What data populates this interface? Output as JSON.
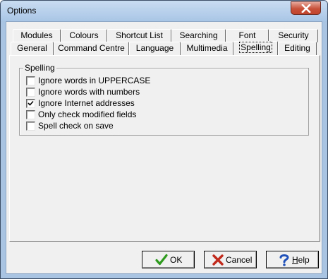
{
  "window": {
    "title": "Options"
  },
  "tabs": {
    "row1": [
      {
        "label": "Modules"
      },
      {
        "label": "Colours"
      },
      {
        "label": "Shortcut List"
      },
      {
        "label": "Searching"
      },
      {
        "label": "Font"
      },
      {
        "label": "Security"
      }
    ],
    "row2": [
      {
        "label": "General"
      },
      {
        "label": "Command Centre"
      },
      {
        "label": "Language"
      },
      {
        "label": "Multimedia"
      },
      {
        "label": "Spelling",
        "active": true
      },
      {
        "label": "Editing"
      }
    ]
  },
  "spelling": {
    "group_label": "Spelling",
    "options": [
      {
        "label": "Ignore words in UPPERCASE",
        "checked": false
      },
      {
        "label": "Ignore words with numbers",
        "checked": false
      },
      {
        "label": "Ignore Internet addresses",
        "checked": true
      },
      {
        "label": "Only check modified fields",
        "checked": false
      },
      {
        "label": "Spell check on save",
        "checked": false
      }
    ]
  },
  "buttons": {
    "ok": {
      "label": "OK",
      "icon": "check-icon",
      "color": "#2e9a1e"
    },
    "cancel": {
      "label": "Cancel",
      "icon": "cross-icon",
      "color": "#c0291b"
    },
    "help": {
      "label_prefix": "",
      "label_underlined": "H",
      "label_rest": "elp",
      "icon": "question-icon",
      "color": "#1f4fb8"
    }
  }
}
